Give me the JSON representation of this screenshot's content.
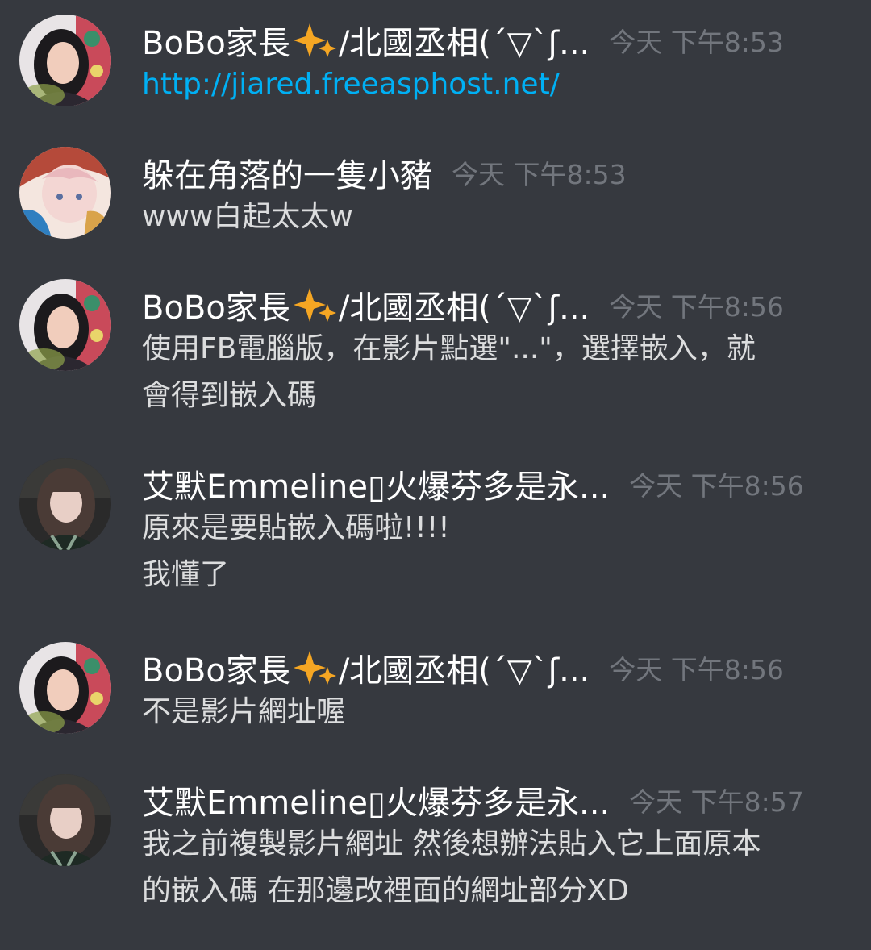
{
  "messages": [
    {
      "author_before": "BoBo家長",
      "author_after": "/北國丞相(´▽`ʃ...",
      "sparkle": true,
      "time": "今天 下午8:53",
      "avatar": "woman-portrait-avatar",
      "lines": [],
      "link": "http://jiared.freeasphost.net/"
    },
    {
      "author_before": "躲在角落的一隻小豬",
      "author_after": "",
      "sparkle": false,
      "time": "今天 下午8:53",
      "avatar": "anime-character-avatar",
      "lines": [
        "www白起太太w"
      ],
      "link": ""
    },
    {
      "author_before": "BoBo家長",
      "author_after": "/北國丞相(´▽`ʃ...",
      "sparkle": true,
      "time": "今天 下午8:56",
      "avatar": "woman-portrait-avatar",
      "lines": [
        "使用FB電腦版，在影片點選\"...\"，選擇嵌入，就",
        "會得到嵌入碼"
      ],
      "link": ""
    },
    {
      "author_before": "艾默Emmeline▯火爆芬多是永...",
      "author_after": "",
      "sparkle": false,
      "time": "今天 下午8:56",
      "avatar": "girl-photo-avatar",
      "lines": [
        "原來是要貼嵌入碼啦!!!!",
        "我懂了"
      ],
      "link": ""
    },
    {
      "author_before": "BoBo家長",
      "author_after": "/北國丞相(´▽`ʃ...",
      "sparkle": true,
      "time": "今天 下午8:56",
      "avatar": "woman-portrait-avatar",
      "lines": [
        "不是影片網址喔"
      ],
      "link": ""
    },
    {
      "author_before": "艾默Emmeline▯火爆芬多是永...",
      "author_after": "",
      "sparkle": false,
      "time": "今天 下午8:57",
      "avatar": "girl-photo-avatar",
      "lines": [
        "我之前複製影片網址 然後想辦法貼入它上面原本",
        "的嵌入碼 在那邊改裡面的網址部分XD"
      ],
      "link": ""
    }
  ],
  "colors": {
    "background": "#36393f",
    "author": "#ffffff",
    "timestamp": "#72767d",
    "text": "#dcddde",
    "link": "#00b0f4",
    "sparkle": "#f5a623"
  }
}
